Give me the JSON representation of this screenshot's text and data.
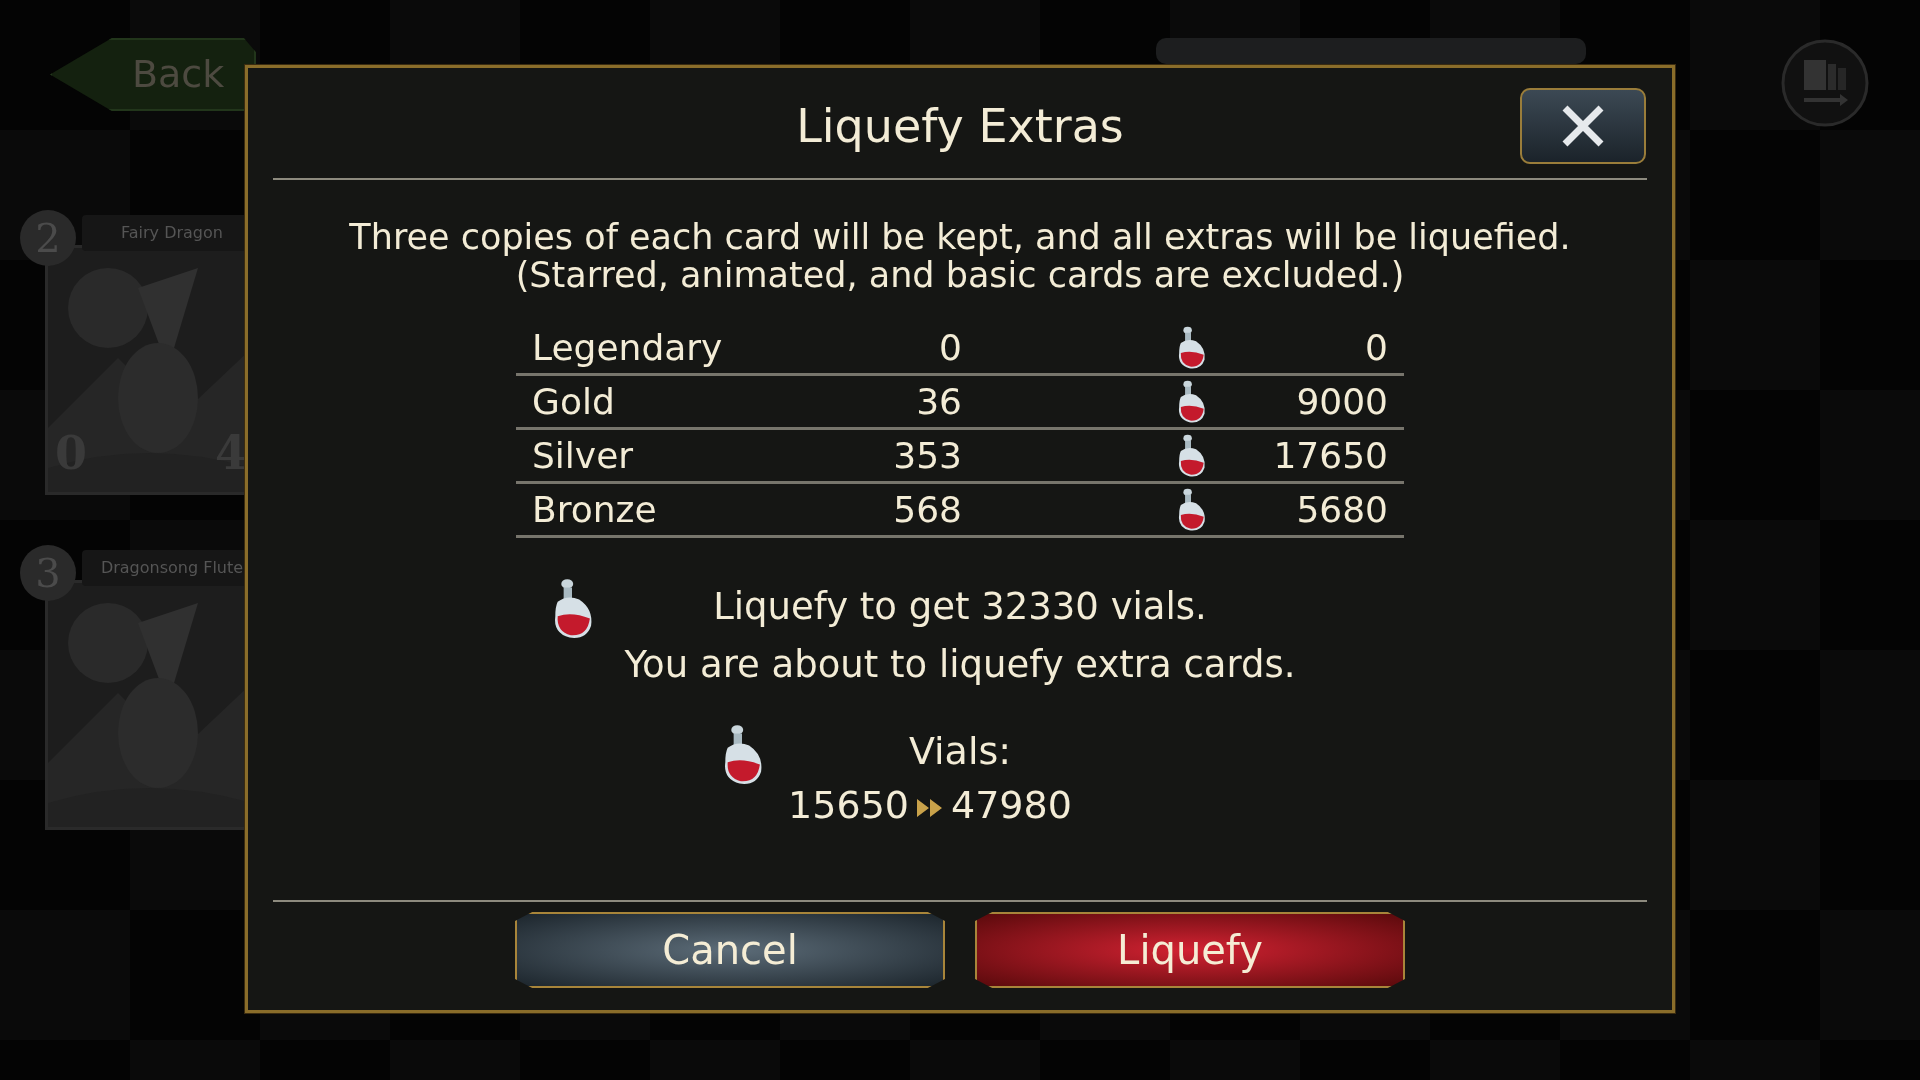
{
  "background": {
    "back_button": "Back",
    "cards": [
      {
        "name": "Fairy Dragon",
        "cost": "2",
        "attack": "0",
        "life": "4"
      },
      {
        "name": "Dragonsong Flute",
        "cost": "3"
      }
    ]
  },
  "dialog": {
    "title": "Liquefy Extras",
    "message": [
      "Three copies of each card will be kept, and all extras will be liquefied.",
      "(Starred, animated, and basic cards are excluded.)"
    ],
    "rows": [
      {
        "rarity": "Legendary",
        "count": "0",
        "vials": "0"
      },
      {
        "rarity": "Gold",
        "count": "36",
        "vials": "9000"
      },
      {
        "rarity": "Silver",
        "count": "353",
        "vials": "17650"
      },
      {
        "rarity": "Bronze",
        "count": "568",
        "vials": "5680"
      }
    ],
    "summary": "Liquefy to get 32330 vials.",
    "confirm": "You are about to liquefy extra cards.",
    "vials_label": "Vials:",
    "vials_before": "15650",
    "vials_after": "47980",
    "buttons": [
      {
        "label": "Cancel",
        "kind": "cancel"
      },
      {
        "label": "Liquefy",
        "kind": "confirm"
      }
    ]
  }
}
